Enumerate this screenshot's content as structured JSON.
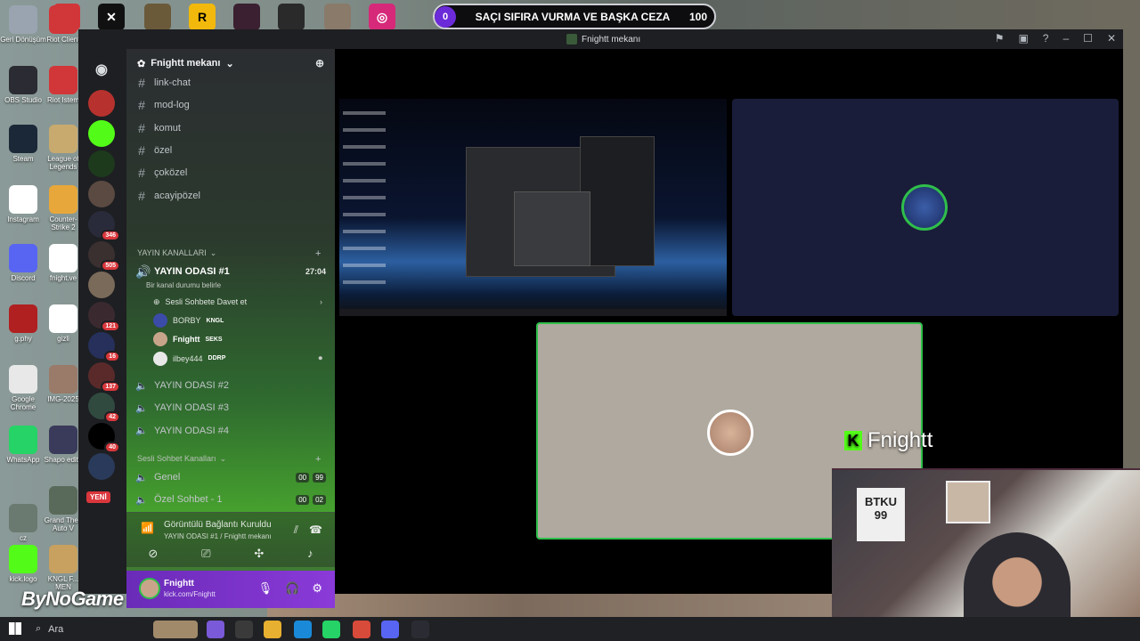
{
  "top": {
    "banner_count": "0",
    "banner_title": "SAÇI SIFIRA VURMA VE BAŞKA CEZA",
    "banner_value": "100"
  },
  "desktop_icons": [
    {
      "label": "Geri Dönüşüm",
      "color": "#9aa4b0"
    },
    {
      "label": "OBS Studio",
      "color": "#2b2b33"
    },
    {
      "label": "Steam",
      "color": "#1b2838"
    },
    {
      "label": "Instagram",
      "color": "#ffffff"
    },
    {
      "label": "Discord",
      "color": "#5865f2"
    },
    {
      "label": "g.phy",
      "color": "#b02020"
    },
    {
      "label": "Google Chrome",
      "color": "#e8e8e8"
    },
    {
      "label": "WhatsApp",
      "color": "#25d366"
    },
    {
      "label": "cz",
      "color": "#6a7a70"
    },
    {
      "label": "kick.logo",
      "color": "#53fc18"
    }
  ],
  "desktop_icons_col2": [
    {
      "label": "Riot Client",
      "color": "#d13639"
    },
    {
      "label": "Riot Istem",
      "color": "#d13639"
    },
    {
      "label": "League of Legends",
      "color": "#c8aa6e"
    },
    {
      "label": "Counter-Strike 2",
      "color": "#e8a73a"
    },
    {
      "label": "fnight.ve",
      "color": "#ffffff"
    },
    {
      "label": "gizli",
      "color": "#ffffff"
    },
    {
      "label": "IMG-2025",
      "color": "#9a7a68"
    },
    {
      "label": "Shapo edite",
      "color": "#3a3a5a"
    },
    {
      "label": "Grand Theft Auto V",
      "color": "#5a6a5a"
    },
    {
      "label": "KNGL F... MEN",
      "color": "#c8a060"
    }
  ],
  "window": {
    "title": "Fnightt mekanı",
    "guild_name": "Fnightt mekanı",
    "new_badge": "YENİ"
  },
  "servers": [
    {
      "color": "#b7322e",
      "badge": ""
    },
    {
      "color": "#53fc18",
      "badge": ""
    },
    {
      "color": "#1d3a1d",
      "badge": ""
    },
    {
      "color": "#5a4a42",
      "badge": ""
    },
    {
      "color": "#2a2b3a",
      "badge": "346"
    },
    {
      "color": "#3a3030",
      "badge": "505"
    },
    {
      "color": "#7a6a5a",
      "badge": ""
    },
    {
      "color": "#3a2a30",
      "badge": "121"
    },
    {
      "color": "#26305a",
      "badge": "16"
    },
    {
      "color": "#5a2a2a",
      "badge": "137"
    },
    {
      "color": "#304a40",
      "badge": "42"
    },
    {
      "color": "#000000",
      "badge": "40"
    },
    {
      "color": "#2a3a5a",
      "badge": ""
    }
  ],
  "channels": {
    "text": [
      "link-chat",
      "mod-log",
      "komut",
      "özel",
      "çoközel",
      "acayipözel"
    ],
    "voice_category": "YAYIN KANALLARI",
    "active_voice": {
      "name": "YAYIN ODASI #1",
      "time": "27:04",
      "status": "Bir kanal durumu belirle"
    },
    "invite": "Sesli Sohbete Davet et",
    "users": [
      {
        "name": "BORBY",
        "tag": "KNGL",
        "color": "#3b4ba8"
      },
      {
        "name": "Fnightt",
        "tag": "SEKS",
        "color": "#c8a58a"
      },
      {
        "name": "ilbey444",
        "tag": "DDRP",
        "color": "#e8e8e8"
      }
    ],
    "other_voice": [
      "YAYIN ODASI #2",
      "YAYIN ODASI #3",
      "YAYIN ODASI #4"
    ],
    "chat_category": "Sesli Sohbet Kanalları",
    "chat_voice": [
      {
        "name": "Genel",
        "a": "00",
        "b": "99"
      },
      {
        "name": "Özel Sohbet - 1",
        "a": "00",
        "b": "02"
      }
    ]
  },
  "voice_panel": {
    "status": "Görüntülü Bağlantı Kuruldu",
    "sub": "YAYIN ODASI #1 / Fnightt mekanı"
  },
  "user_panel": {
    "name": "Fnightt",
    "status": "kick.com/Fnightt"
  },
  "overlay": {
    "kick_name": "Fnightt",
    "jersey": "BTKU 99",
    "brand": "ByNoGame"
  },
  "taskbar": {
    "search": "Ara"
  }
}
